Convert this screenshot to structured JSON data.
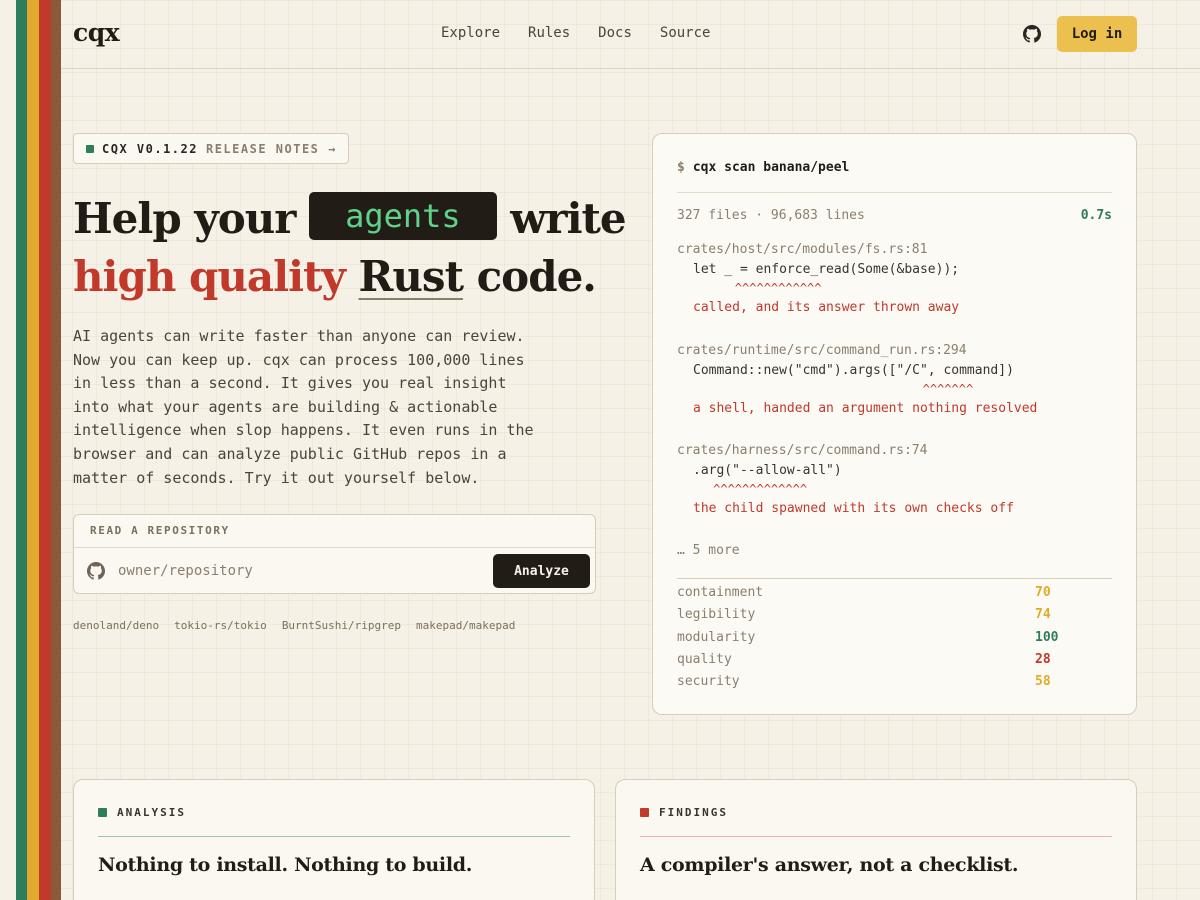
{
  "brand": "cqx",
  "nav": [
    "Explore",
    "Rules",
    "Docs",
    "Source"
  ],
  "header": {
    "login_label": "Log in"
  },
  "release": {
    "version": "CQX V0.1.22",
    "notes_label": "RELEASE NOTES →"
  },
  "hero": {
    "line1_a": "Help your",
    "agents": "agents",
    "line1_b": "write",
    "line2_red": "high quality",
    "line2_rust": "Rust",
    "line2_end": "code.",
    "lede": "AI agents can write faster than anyone can review. Now you can keep up. cqx can process 100,000 lines in less than a second. It gives you real insight into what your agents are building & actionable intelligence when slop happens. It even runs in the browser and can analyze public GitHub repos in a matter of seconds. Try it out yourself below."
  },
  "repo": {
    "label": "READ A REPOSITORY",
    "placeholder": "owner/repository",
    "analyze_label": "Analyze",
    "examples": [
      "denoland/deno",
      "tokio-rs/tokio",
      "BurntSushi/ripgrep",
      "makepad/makepad"
    ]
  },
  "terminal": {
    "prompt": "$",
    "command": "cqx scan banana/peel",
    "stats": "327 files · 96,683 lines",
    "time": "0.7s",
    "findings": [
      {
        "path": "crates/host/src/modules/fs.rs:81",
        "code": "let _ = enforce_read(Some(&base));",
        "caret": "        ^^^^^^^^^^^^",
        "message": "called, and its answer thrown away"
      },
      {
        "path": "crates/runtime/src/command_run.rs:294",
        "code": "Command::new(\"cmd\").args([\"/C\", command])",
        "caret": "                                  ^^^^^^^",
        "message": "a shell, handed an argument nothing resolved"
      },
      {
        "path": "crates/harness/src/command.rs:74",
        "code": ".arg(\"--allow-all\")",
        "caret": "     ^^^^^^^^^^^^^",
        "message": "the child spawned with its own checks off"
      }
    ],
    "more": "… 5 more",
    "scores": [
      {
        "name": "containment",
        "value": "70",
        "color": "#e2aa2d"
      },
      {
        "name": "legibility",
        "value": "74",
        "color": "#e2aa2d"
      },
      {
        "name": "modularity",
        "value": "100",
        "color": "#2e7d5b"
      },
      {
        "name": "quality",
        "value": "28",
        "color": "#c0392b"
      },
      {
        "name": "security",
        "value": "58",
        "color": "#e2aa2d"
      }
    ]
  },
  "cards": {
    "analysis": {
      "tag": "ANALYSIS",
      "title": "Nothing to install. Nothing to build.",
      "color": "#2e7d5b"
    },
    "findings": {
      "tag": "FINDINGS",
      "title": "A compiler's answer, not a checklist.",
      "color": "#c0392b"
    }
  },
  "colors": {
    "green": "#2e7d5b",
    "yellow": "#e2aa2d",
    "red": "#c0392b",
    "brown": "#8a5a3a",
    "dark": "#221c17",
    "login": "#ecc04f"
  },
  "icons": {
    "github": "github-icon"
  }
}
